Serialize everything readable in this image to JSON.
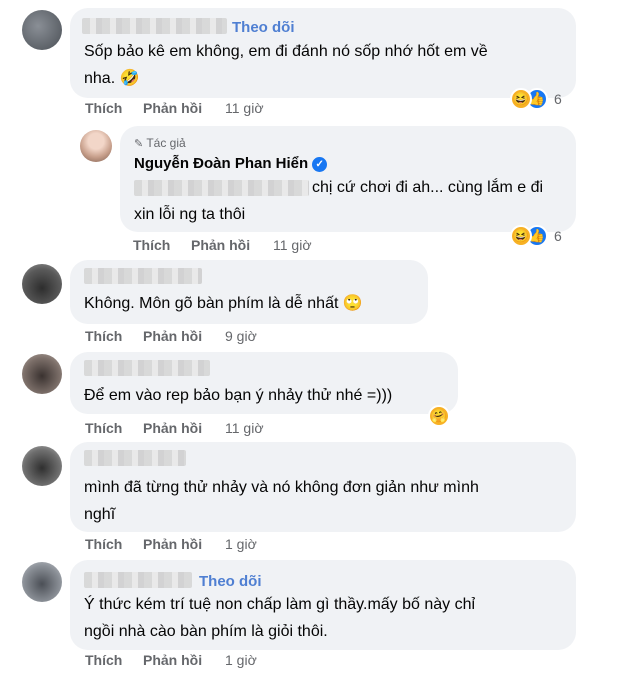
{
  "comments": [
    {
      "follow": "Theo dõi",
      "text_lines": [
        "Sốp bảo kê em không, em đi đánh nó sốp nhớ hốt em về",
        "nha. 🤣"
      ],
      "like": "Thích",
      "reply": "Phản hồi",
      "time": "11 giờ",
      "reaction_count": "6",
      "reaction_icons": [
        "haha-icon",
        "like-icon"
      ]
    },
    {
      "author": "Nguyễn Đoàn Phan Hiển",
      "badge": "Tác giả",
      "text_lines": [
        "chị cứ chơi đi ah... cùng lắm e đi",
        "xin lỗi ng ta thôi"
      ],
      "like": "Thích",
      "reply": "Phản hồi",
      "time": "11 giờ",
      "reaction_count": "6",
      "reaction_icons": [
        "haha-icon",
        "like-icon"
      ]
    },
    {
      "text_lines": [
        "Không. Môn gõ bàn phím là dễ nhất 🙄"
      ],
      "like": "Thích",
      "reply": "Phản hồi",
      "time": "9 giờ"
    },
    {
      "text_lines": [
        "Để em vào rep bảo bạn ý nhảy thử nhé =)))"
      ],
      "like": "Thích",
      "reply": "Phản hồi",
      "time": "11 giờ",
      "reaction_icons": [
        "care-icon"
      ]
    },
    {
      "text_lines": [
        "mình đã từng thử nhảy và nó không đơn giản như mình",
        "nghĩ"
      ],
      "like": "Thích",
      "reply": "Phản hồi",
      "time": "1 giờ"
    },
    {
      "follow": "Theo dõi",
      "text_lines": [
        "Ý thức kém trí tuệ non chấp làm gì thầy.mấy bố này chỉ",
        "ngồi nhà cào bàn phím là giỏi thôi."
      ],
      "like": "Thích",
      "reply": "Phản hồi",
      "time": "1 giờ"
    }
  ]
}
